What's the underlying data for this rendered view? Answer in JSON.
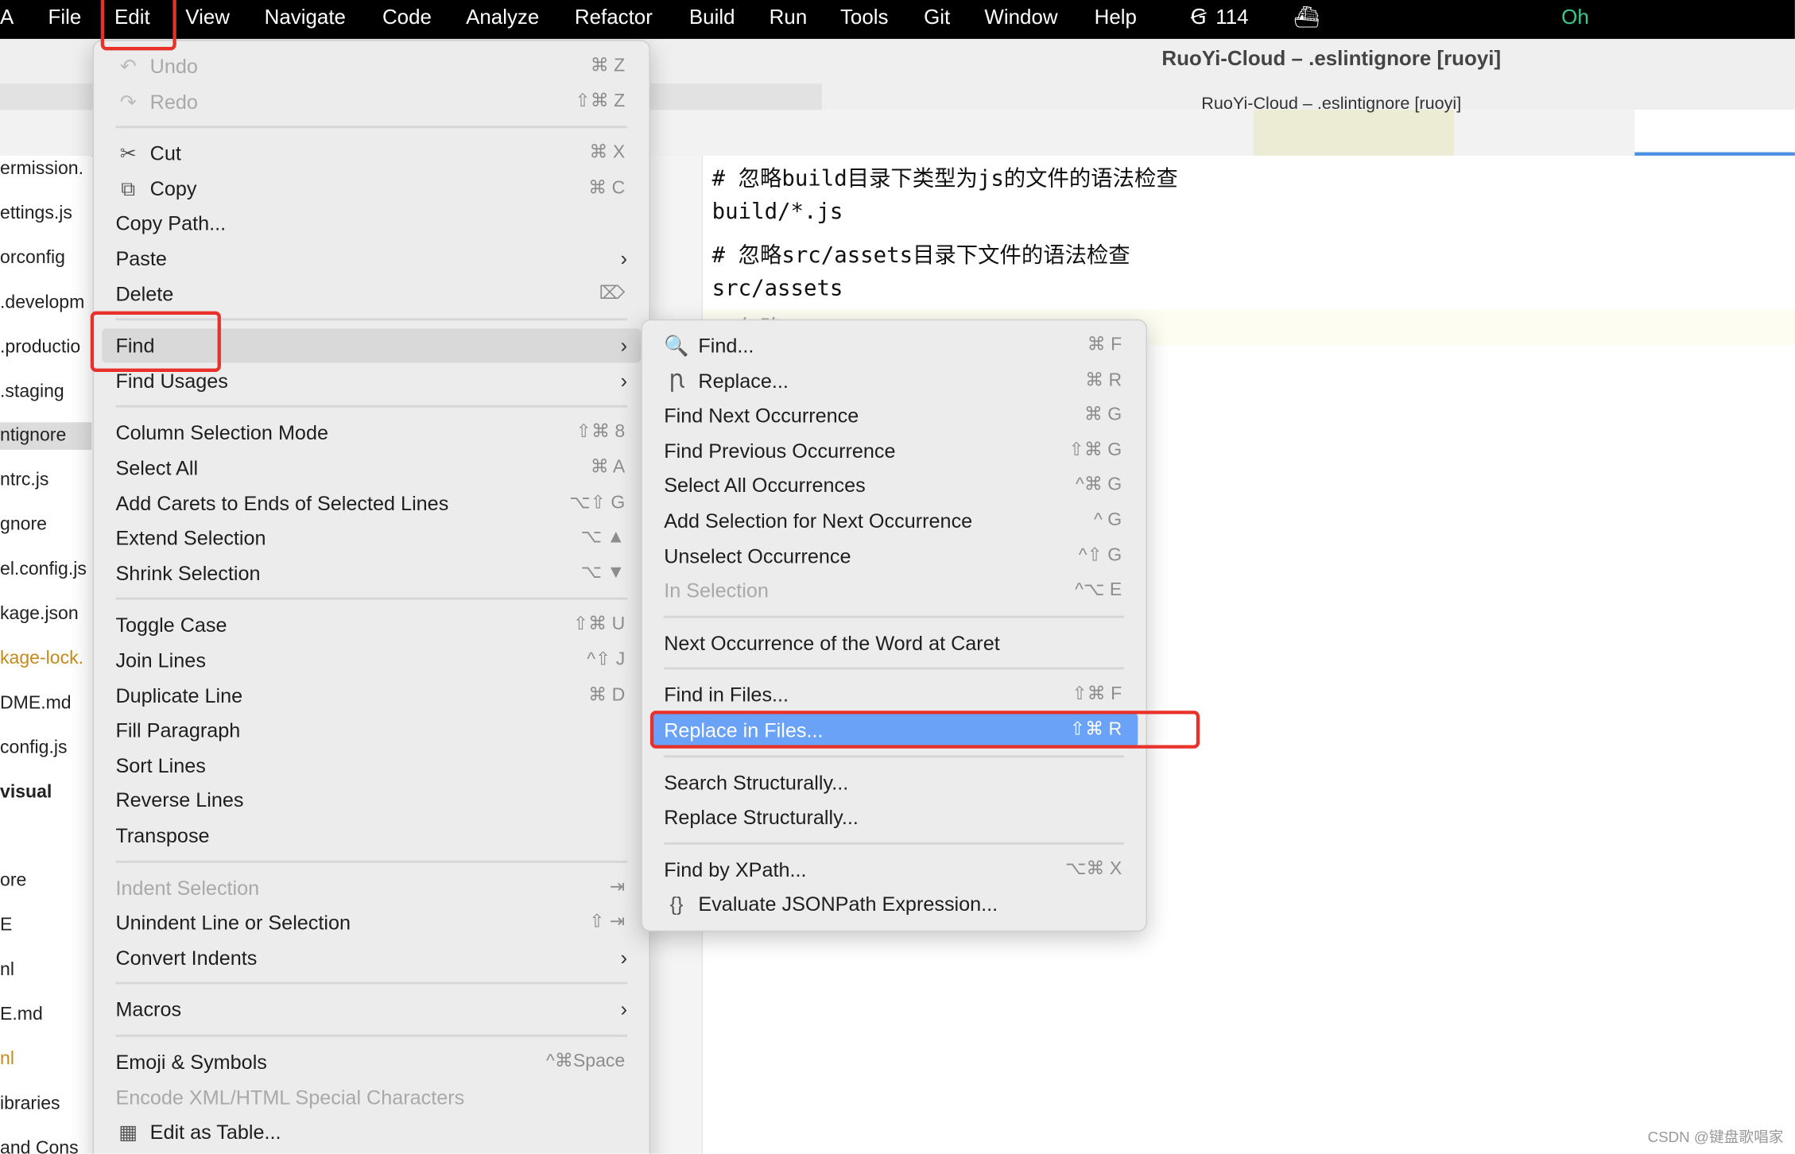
{
  "menubar": {
    "app_partial": "A",
    "items": [
      "File",
      "Edit",
      "View",
      "Navigate",
      "Code",
      "Analyze",
      "Refactor",
      "Build",
      "Run",
      "Tools",
      "Git",
      "Window",
      "Help"
    ],
    "badge_count": "114",
    "status_text": "Oh",
    "status_color": "#3cc98a"
  },
  "window": {
    "title": "RuoYi-Cloud – .eslintignore [ruoyi]",
    "subtitle": "RuoYi-Cloud – .eslintignore [ruoyi]"
  },
  "sidebar": {
    "items": [
      {
        "label": "ermission.",
        "style": "normal"
      },
      {
        "label": "ettings.js",
        "style": "normal"
      },
      {
        "label": "orconfig",
        "style": "normal"
      },
      {
        "label": ".developm",
        "style": "normal"
      },
      {
        "label": ".productio",
        "style": "normal"
      },
      {
        "label": ".staging",
        "style": "normal"
      },
      {
        "label": "ntignore",
        "style": "selected"
      },
      {
        "label": "ntrc.js",
        "style": "normal"
      },
      {
        "label": "gnore",
        "style": "normal"
      },
      {
        "label": "el.config.js",
        "style": "normal"
      },
      {
        "label": "kage.json",
        "style": "normal"
      },
      {
        "label": "kage-lock.",
        "style": "orange"
      },
      {
        "label": "DME.md",
        "style": "normal"
      },
      {
        "label": "config.js",
        "style": "normal"
      },
      {
        "label": "visual",
        "style": "bold"
      },
      {
        "label": "",
        "style": "normal"
      },
      {
        "label": "ore",
        "style": "normal"
      },
      {
        "label": "E",
        "style": "normal"
      },
      {
        "label": "nl",
        "style": "normal"
      },
      {
        "label": "E.md",
        "style": "normal"
      },
      {
        "label": "nl",
        "style": "orange"
      },
      {
        "label": "ibraries",
        "style": "normal"
      },
      {
        "label": "and Cons",
        "style": "normal"
      }
    ]
  },
  "editor": {
    "lines": [
      "# 忽略build目录下类型为js的文件的语法检查",
      "build/*.js",
      "# 忽略src/assets目录下文件的语法检查",
      "src/assets",
      "# 忽略..."
    ]
  },
  "edit_menu": {
    "items": [
      {
        "label": "Undo",
        "shortcut": "⌘ Z",
        "icon": "undo-icon",
        "glyph": "↶",
        "disabled": true
      },
      {
        "label": "Redo",
        "shortcut": "⇧⌘ Z",
        "icon": "redo-icon",
        "glyph": "↷",
        "disabled": true
      },
      {
        "sep": true
      },
      {
        "label": "Cut",
        "shortcut": "⌘ X",
        "icon": "scissors-icon",
        "glyph": "✂"
      },
      {
        "label": "Copy",
        "shortcut": "⌘ C",
        "icon": "copy-icon",
        "glyph": "⧉"
      },
      {
        "label": "Copy Path..."
      },
      {
        "label": "Paste",
        "submenu": true
      },
      {
        "label": "Delete",
        "shortcut": "⌦"
      },
      {
        "sep": true
      },
      {
        "label": "Find",
        "submenu": true,
        "highlight": "gray"
      },
      {
        "label": "Find Usages",
        "submenu": true
      },
      {
        "sep": true
      },
      {
        "label": "Column Selection Mode",
        "shortcut": "⇧⌘ 8"
      },
      {
        "label": "Select All",
        "shortcut": "⌘ A"
      },
      {
        "label": "Add Carets to Ends of Selected Lines",
        "shortcut": "⌥⇧ G"
      },
      {
        "label": "Extend Selection",
        "shortcut": "⌥ ▲"
      },
      {
        "label": "Shrink Selection",
        "shortcut": "⌥ ▼"
      },
      {
        "sep": true
      },
      {
        "label": "Toggle Case",
        "shortcut": "⇧⌘ U"
      },
      {
        "label": "Join Lines",
        "shortcut": "^⇧ J"
      },
      {
        "label": "Duplicate Line",
        "shortcut": "⌘ D"
      },
      {
        "label": "Fill Paragraph"
      },
      {
        "label": "Sort Lines"
      },
      {
        "label": "Reverse Lines"
      },
      {
        "label": "Transpose"
      },
      {
        "sep": true
      },
      {
        "label": "Indent Selection",
        "shortcut": "⇥",
        "disabled": true
      },
      {
        "label": "Unindent Line or Selection",
        "shortcut": "⇧ ⇥"
      },
      {
        "label": "Convert Indents",
        "submenu": true
      },
      {
        "sep": true
      },
      {
        "label": "Macros",
        "submenu": true
      },
      {
        "sep": true
      },
      {
        "label": "Emoji & Symbols",
        "shortcut": "^⌘Space"
      },
      {
        "label": "Encode XML/HTML Special Characters",
        "disabled": true
      },
      {
        "label": "Edit as Table...",
        "icon": "table-icon",
        "glyph": "▦"
      }
    ]
  },
  "find_submenu": {
    "items": [
      {
        "label": "Find...",
        "shortcut": "⌘ F",
        "icon": "search-icon",
        "glyph": "🔍"
      },
      {
        "label": "Replace...",
        "shortcut": "⌘ R",
        "icon": "replace-icon",
        "glyph": "Ꞃ"
      },
      {
        "label": "Find Next Occurrence",
        "shortcut": "⌘ G"
      },
      {
        "label": "Find Previous Occurrence",
        "shortcut": "⇧⌘ G"
      },
      {
        "label": "Select All Occurrences",
        "shortcut": "^⌘ G"
      },
      {
        "label": "Add Selection for Next Occurrence",
        "shortcut": "^ G"
      },
      {
        "label": "Unselect Occurrence",
        "shortcut": "^⇧ G"
      },
      {
        "label": "In Selection",
        "shortcut": "^⌥ E",
        "disabled": true
      },
      {
        "sep": true
      },
      {
        "label": "Next Occurrence of the Word at Caret"
      },
      {
        "sep": true
      },
      {
        "label": "Find in Files...",
        "shortcut": "⇧⌘ F"
      },
      {
        "label": "Replace in Files...",
        "shortcut": "⇧⌘ R",
        "highlight": "blue"
      },
      {
        "sep": true
      },
      {
        "label": "Search Structurally..."
      },
      {
        "label": "Replace Structurally..."
      },
      {
        "sep": true
      },
      {
        "label": "Find by XPath...",
        "shortcut": "⌥⌘ X"
      },
      {
        "label": "Evaluate JSONPath Expression...",
        "icon": "jsonpath-icon",
        "glyph": "{}"
      }
    ]
  },
  "watermark": "CSDN @键盘歌唱家",
  "colors": {
    "highlight_blue": "#6aa2f7",
    "annotation_red": "#e8312a",
    "tab_active": "#4a90e2"
  }
}
